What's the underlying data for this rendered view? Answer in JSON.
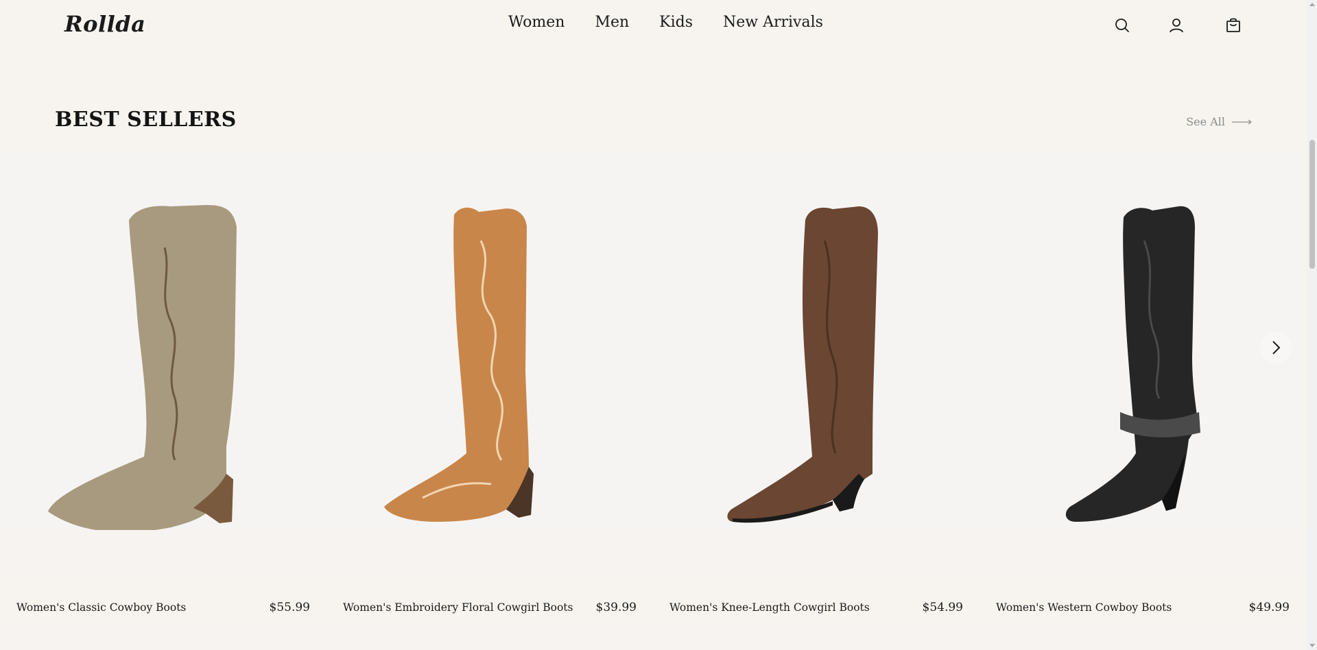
{
  "header": {
    "logo": "Rollda",
    "nav": [
      {
        "label": "Women"
      },
      {
        "label": "Men"
      },
      {
        "label": "Kids"
      },
      {
        "label": "New Arrivals"
      }
    ],
    "icons": [
      "search-icon",
      "account-icon",
      "shopping-bag-icon"
    ]
  },
  "section": {
    "title": "BEST SELLERS",
    "see_all": "See All"
  },
  "products": [
    {
      "name": "Women's Classic Cowboy Boots",
      "price": "$55.99",
      "color": "#a89a7e",
      "accent": "#6b5a3d",
      "sole": "#7a5a3e"
    },
    {
      "name": "Women's Embroidery Floral Cowgirl Boots",
      "price": "$39.99",
      "color": "#c9864a",
      "accent": "#f1d6b3",
      "sole": "#4a3526"
    },
    {
      "name": "Women's Knee-Length Cowgirl Boots",
      "price": "$54.99",
      "color": "#6b4632",
      "accent": "#4d3020",
      "sole": "#1a1a1a"
    },
    {
      "name": "Women's Western Cowboy Boots",
      "price": "$49.99",
      "color": "#262626",
      "accent": "#4a4a4a",
      "sole": "#111111"
    }
  ],
  "colors": {
    "background": "#f7f4ef",
    "text": "#1b1b1b",
    "muted": "#8b8b8b"
  }
}
